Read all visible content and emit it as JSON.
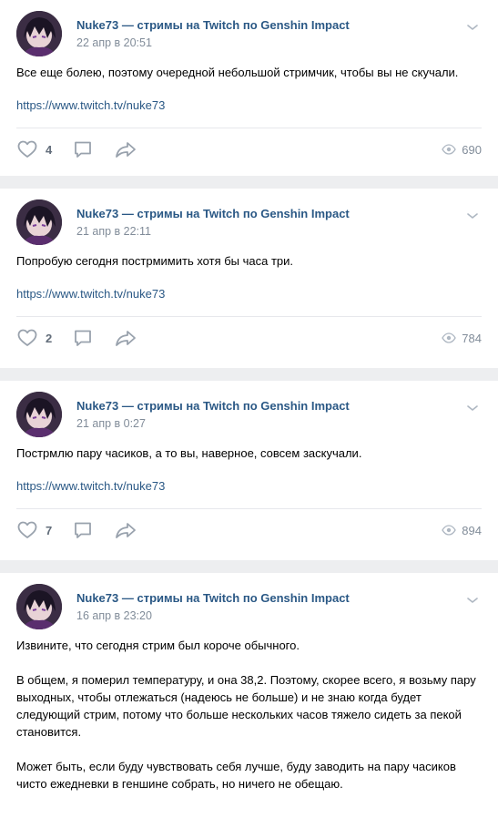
{
  "posts": [
    {
      "author": "Nuke73 — стримы на Twitch по Genshin Impact",
      "date": "22 апр в 20:51",
      "text": "Все еще болею, поэтому очередной небольшой стримчик, чтобы вы не скучали.",
      "link": "https://www.twitch.tv/nuke73",
      "likes": "4",
      "views": "690"
    },
    {
      "author": "Nuke73 — стримы на Twitch по Genshin Impact",
      "date": "21 апр в 22:11",
      "text": "Попробую сегодня пострмимить хотя бы часа три.",
      "link": "https://www.twitch.tv/nuke73",
      "likes": "2",
      "views": "784"
    },
    {
      "author": "Nuke73 — стримы на Twitch по Genshin Impact",
      "date": "21 апр в 0:27",
      "text": "Пострмлю пару часиков, а то вы, наверное, совсем заскучали.",
      "link": "https://www.twitch.tv/nuke73",
      "likes": "7",
      "views": "894"
    },
    {
      "author": "Nuke73 — стримы на Twitch по Genshin Impact",
      "date": "16 апр в 23:20",
      "text": "Извините, что сегодня стрим был короче обычного.\n\nВ общем, я померил температуру, и она 38,2. Поэтому, скорее всего, я возьму пару выходных, чтобы отлежаться (надеюсь не больше) и не знаю когда будет следующий стрим, потому что больше нескольких часов тяжело сидеть за пекой становится.\n\nМожет быть, если буду чувствовать себя лучше, буду заводить на пару часиков чисто ежедневки в геншине собрать, но ничего не обещаю."
    }
  ],
  "icons": {
    "avatar": "avatar-anime-character",
    "menu": "chevron-down-icon",
    "like": "heart-icon",
    "comment": "comment-icon",
    "share": "share-icon",
    "views": "eye-icon"
  },
  "colors": {
    "link": "#2a5885",
    "muted": "#818c99",
    "icon": "#99a2ad",
    "background": "#edeef0"
  }
}
